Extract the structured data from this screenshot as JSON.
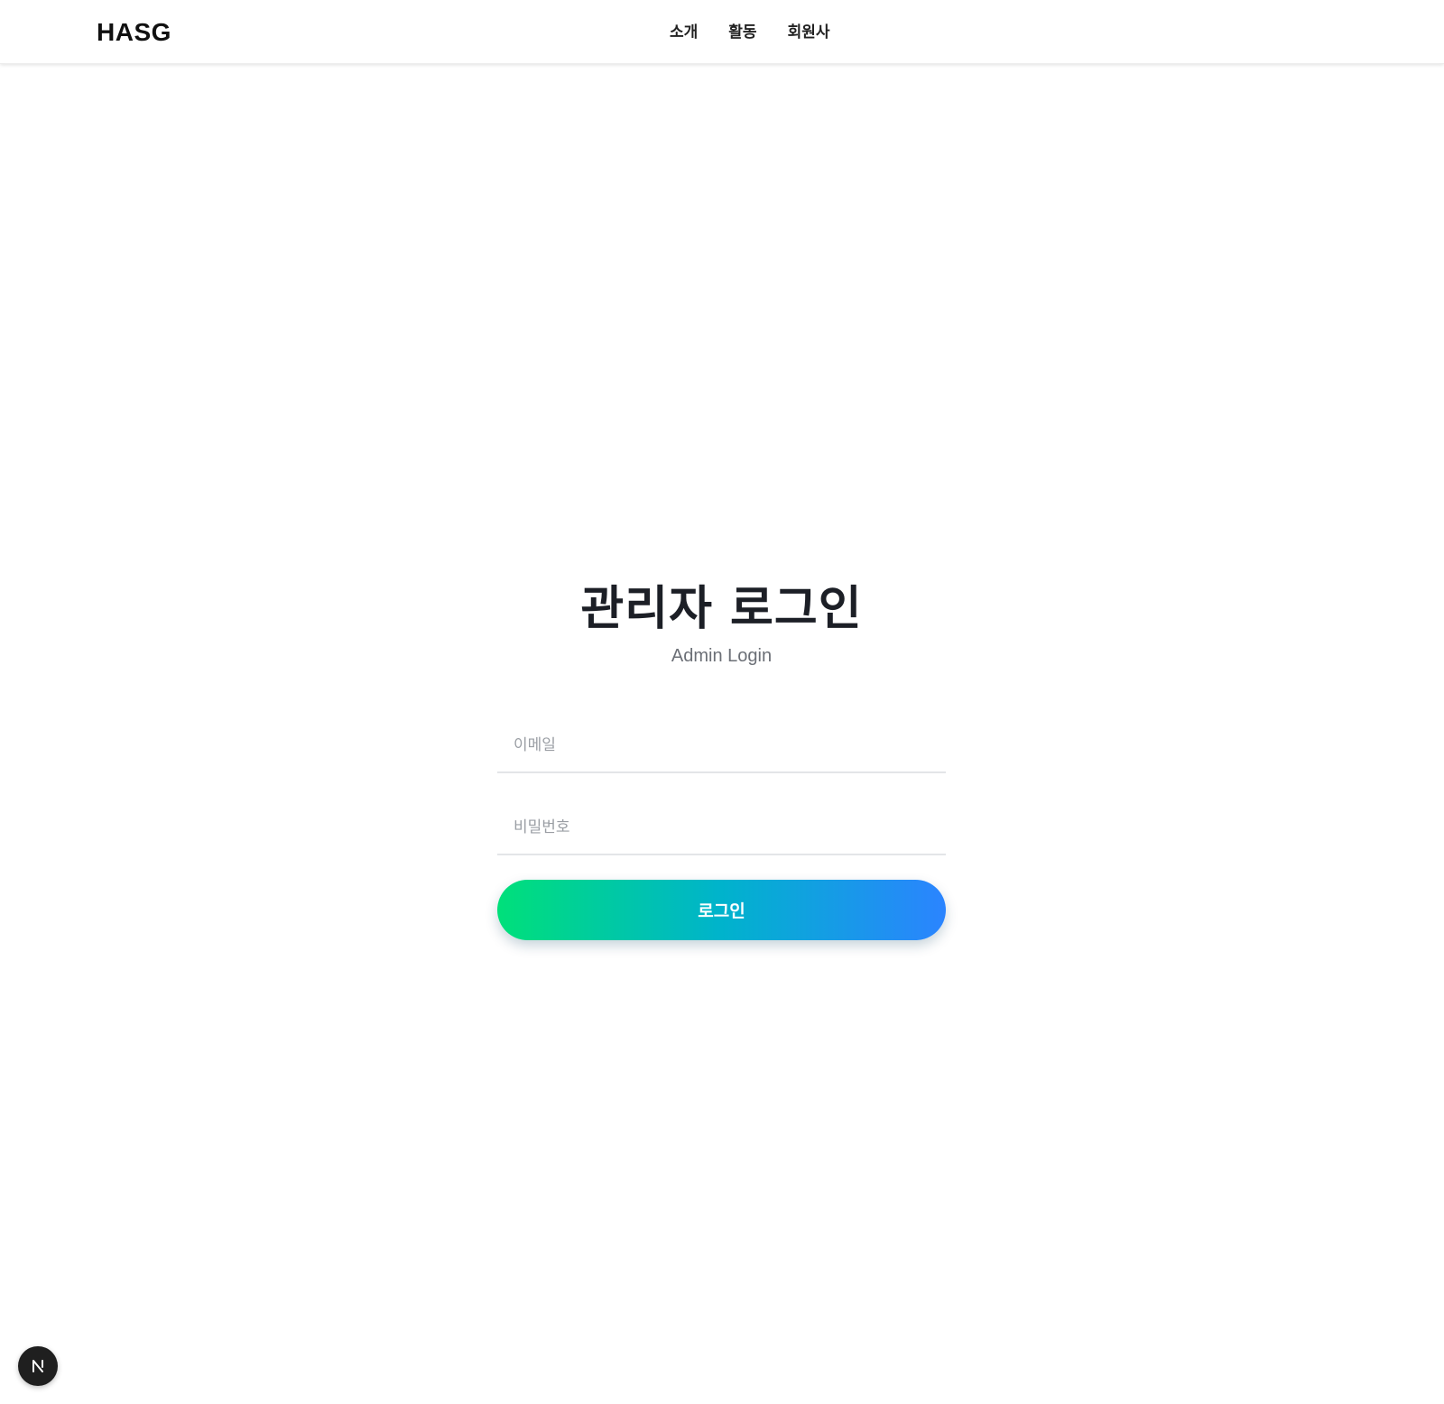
{
  "header": {
    "logo": "HASG",
    "nav": [
      {
        "label": "소개"
      },
      {
        "label": "활동"
      },
      {
        "label": "회원사"
      }
    ]
  },
  "login": {
    "title": "관리자 로그인",
    "subtitle": "Admin Login",
    "email_placeholder": "이메일",
    "email_value": "",
    "password_placeholder": "비밀번호",
    "password_value": "",
    "submit_label": "로그인"
  },
  "colors": {
    "gradient_start": "#00e07a",
    "gradient_end": "#2b84ff",
    "title": "#1c1f26"
  },
  "icons": {
    "dev_badge": "nextjs-icon"
  }
}
